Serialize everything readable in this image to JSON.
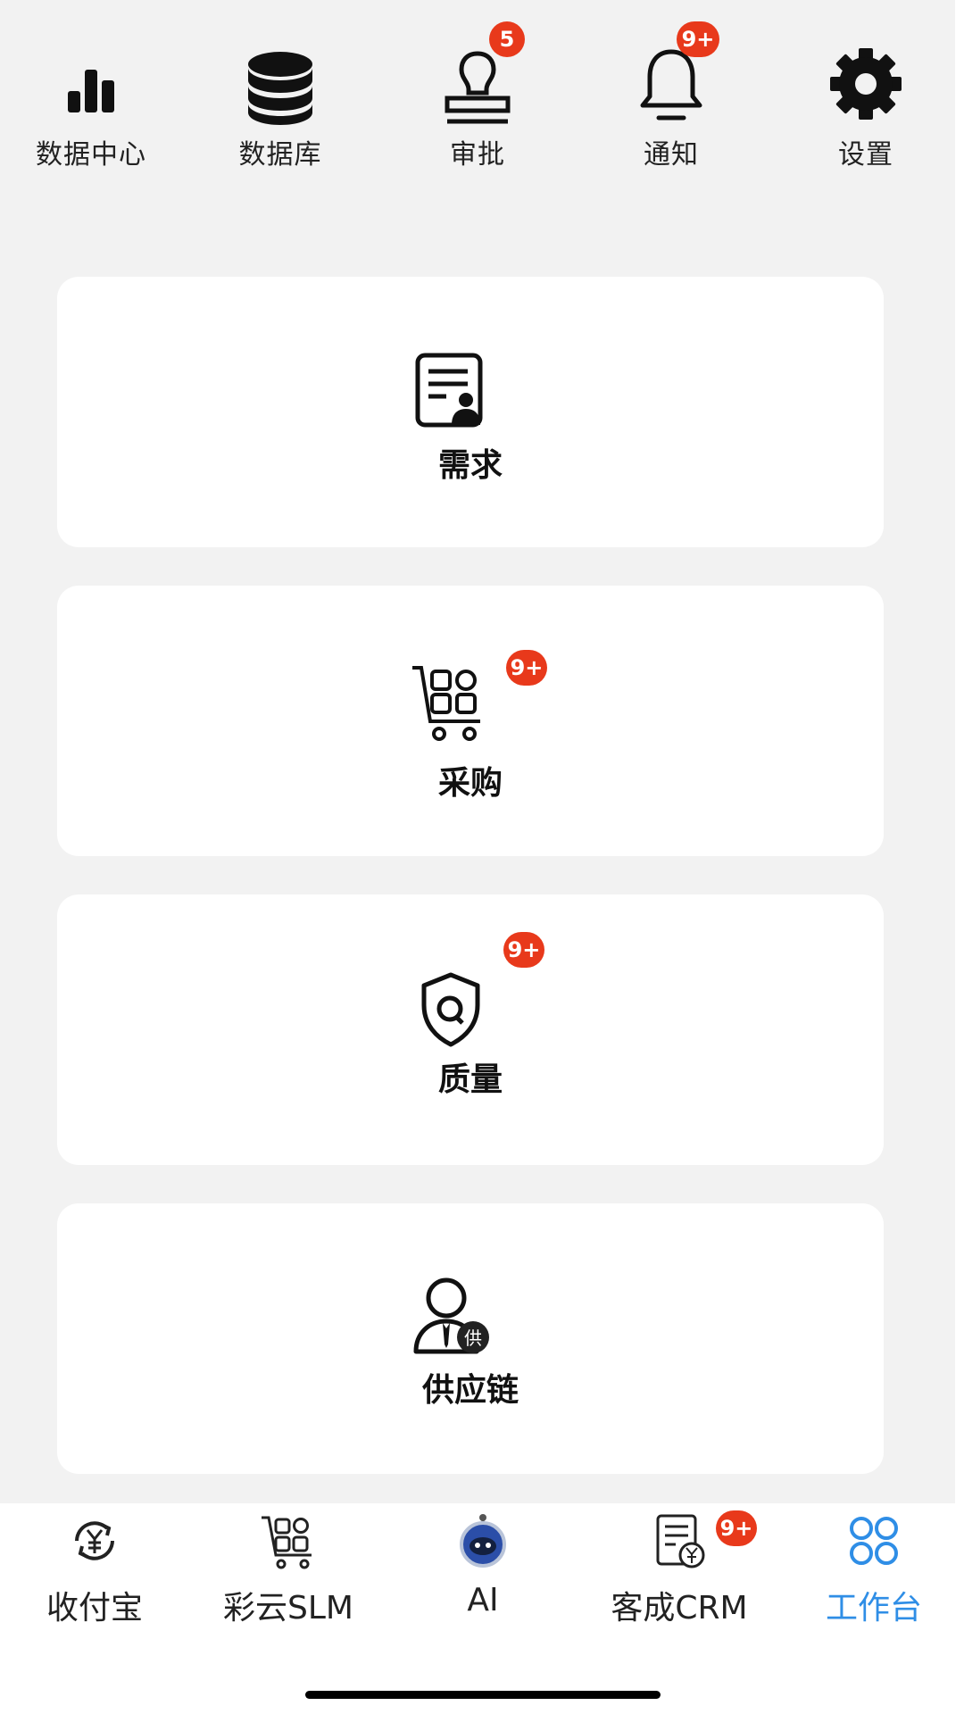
{
  "top_shortcuts": [
    {
      "label": "数据中心",
      "icon": "bar-chart-icon"
    },
    {
      "label": "数据库",
      "icon": "database-icon"
    },
    {
      "label": "审批",
      "icon": "stamp-icon",
      "badge": "5"
    },
    {
      "label": "通知",
      "icon": "bell-icon",
      "badge": "9+"
    },
    {
      "label": "设置",
      "icon": "gear-icon"
    }
  ],
  "cards": [
    {
      "label": "需求",
      "icon": "requirement-document-icon"
    },
    {
      "label": "采购",
      "icon": "shopping-cart-icon",
      "badge": "9+"
    },
    {
      "label": "质量",
      "icon": "quality-shield-icon",
      "badge": "9+"
    },
    {
      "label": "供应链",
      "icon": "supplier-person-icon",
      "icon_char": "供"
    }
  ],
  "bottom_nav": [
    {
      "label": "收付宝",
      "icon": "yen-refresh-icon"
    },
    {
      "label": "彩云SLM",
      "icon": "cart-icon"
    },
    {
      "label": "AI",
      "icon": "robot-icon"
    },
    {
      "label": "客成CRM",
      "icon": "invoice-icon",
      "badge": "9+"
    },
    {
      "label": "工作台",
      "icon": "workbench-grid-icon",
      "active": true
    }
  ],
  "colors": {
    "badge": "#e8391b",
    "active_tab": "#2f8ee6",
    "background": "#f2f2f2",
    "card": "#ffffff"
  }
}
